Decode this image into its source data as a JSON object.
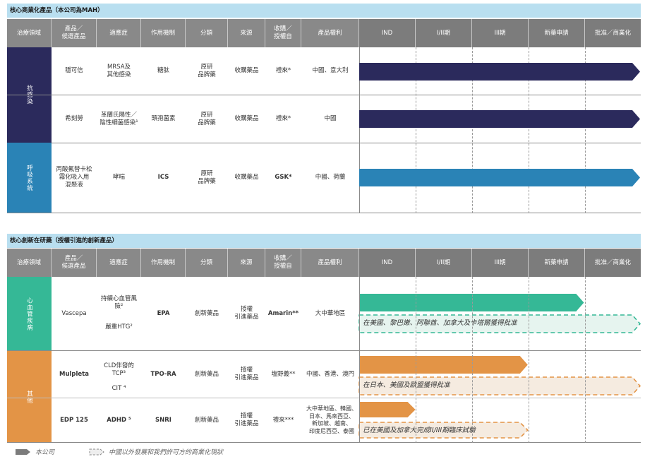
{
  "section1": {
    "title": "核心商業化產品（本公司為MAH）",
    "headers": [
      "治療領域",
      "產品／\n候選產品",
      "適應症",
      "作用機制",
      "分類",
      "來源",
      "收購／\n授權自",
      "產品權利",
      "IND",
      "I/II期",
      "III期",
      "新藥申請",
      "批准／商業化"
    ],
    "area1": "抗感染",
    "area2": "呼吸系統",
    "rows": [
      {
        "product": "穩可信",
        "indication": "MRSA及\n其他感染",
        "mechanism": "糖肽",
        "category": "原研\n品牌藥",
        "source": "收購藥品",
        "from": "禮來*",
        "rights": "中國、意大利"
      },
      {
        "product": "希刻勞",
        "indication": "革蘭氏陽性／\n陰性細菌感染¹",
        "mechanism": "頭孢菌素",
        "category": "原研\n品牌藥",
        "source": "收購藥品",
        "from": "禮來*",
        "rights": "中國"
      },
      {
        "product": "丙酸氟替卡松\n霧化吸入用\n混懸液",
        "indication": "哮喘",
        "mechanism": "ICS",
        "category": "原研\n品牌藥",
        "source": "收購藥品",
        "from": "GSK*",
        "rights": "中國、荷蘭"
      }
    ]
  },
  "section2": {
    "title": "核心創新在研藥（授權引進的創新產品）",
    "headers": [
      "治療領域",
      "產品／\n候選產品",
      "適應症",
      "作用機制",
      "分類",
      "來源",
      "收購／\n授權自",
      "產品權利",
      "IND",
      "I/II期",
      "III期",
      "新藥申請",
      "批准／商業化"
    ],
    "area1": "心血管疾病",
    "area2": "其他",
    "rows": [
      {
        "product": "Vascepa",
        "indication_a": "持續心血管風險²",
        "indication_b": "嚴重HTG²",
        "mechanism": "EPA",
        "category": "創新藥品",
        "source": "授權\n引進藥品",
        "from": "Amarin**",
        "rights": "大中華地區",
        "overseas": "在美國、黎巴嫩、阿聯酋、加拿大及卡塔爾獲得批准"
      },
      {
        "product": "Mulpleta",
        "indication_a": "CLD伴發的\nTCP³",
        "indication_b": "CIT ⁴",
        "mechanism": "TPO-RA",
        "category": "創新藥品",
        "source": "授權\n引進藥品",
        "from": "塩野義**",
        "rights": "中國、香港、澳門",
        "overseas": "在日本、美國及歐盟獲得批准"
      },
      {
        "product": "EDP 125",
        "indication_a": "ADHD ⁵",
        "mechanism": "SNRI",
        "category": "創新藥品",
        "source": "授權\n引進藥品",
        "from": "禮來***",
        "rights": "大中華地區、韓國、\n日本、馬來西亞、\n新加坡、越南、\n印度尼西亞、泰國",
        "overseas": "已在美國及加拿大完成II/III期臨床試驗"
      }
    ]
  },
  "legend": {
    "company": "本公司",
    "partner": "中國以外發展和我們許可方的商業化現狀"
  },
  "colors": {
    "anti_infective": "#2b2a5c",
    "respiratory": "#2a83b6",
    "cardiovascular": "#35b896",
    "others": "#e39446",
    "header_bg": "#898989",
    "title_bg": "#b9dff0"
  },
  "progress": {
    "stage_names": [
      "IND",
      "I/II期",
      "III期",
      "新藥申請",
      "批准／商業化"
    ],
    "s1": [
      1.0,
      1.0,
      1.0
    ],
    "s2_company": [
      0.8,
      0.6,
      0.2
    ],
    "s2_partner": [
      1.0,
      1.0,
      0.6
    ]
  }
}
